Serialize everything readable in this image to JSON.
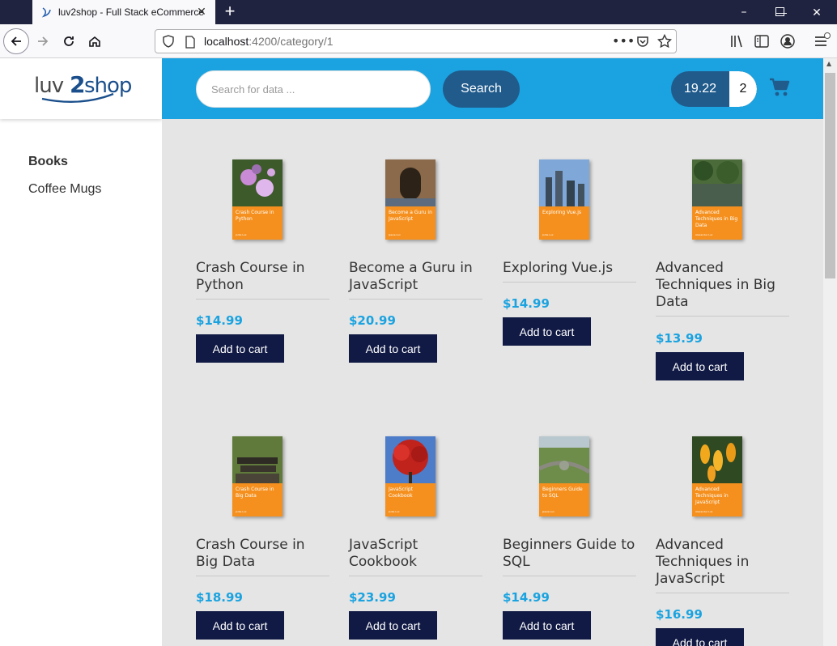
{
  "browser": {
    "tab_title": "luv2shop - Full Stack eCommerce",
    "url_host": "localhost",
    "url_rest": ":4200/category/1",
    "new_tab_label": "+",
    "tab_close": "✕"
  },
  "brand": {
    "logo_text": "luv2shop"
  },
  "sidebar": {
    "categories": [
      {
        "label": "Books"
      },
      {
        "label": "Coffee Mugs"
      }
    ]
  },
  "header": {
    "search_placeholder": "Search for data ...",
    "search_label": "Search",
    "cart_total": "19.22",
    "cart_quantity": "2"
  },
  "products": [
    {
      "name": "Crash Course in Python",
      "price": "$14.99",
      "button": "Add to cart",
      "cover_title": "Crash Course in Python",
      "cover_author": "Jodie Lux"
    },
    {
      "name": "Become a Guru in JavaScript",
      "price": "$20.99",
      "button": "Add to cart",
      "cover_title": "Become a Guru in JavaScript",
      "cover_author": "Jessie Lux"
    },
    {
      "name": "Exploring Vue.js",
      "price": "$14.99",
      "button": "Add to cart",
      "cover_title": "Exploring Vue.js",
      "cover_author": "Jodie Lux"
    },
    {
      "name": "Advanced Techniques in Big Data",
      "price": "$13.99",
      "button": "Add to cart",
      "cover_title": "Advanced Techniques in Big Data",
      "cover_author": "Alexander Lux"
    },
    {
      "name": "Crash Course in Big Data",
      "price": "$18.99",
      "button": "Add to cart",
      "cover_title": "Crash Course in Big Data",
      "cover_author": "Jodie Lux"
    },
    {
      "name": "JavaScript Cookbook",
      "price": "$23.99",
      "button": "Add to cart",
      "cover_title": "JavaScript Cookbook",
      "cover_author": "Jodie Lux"
    },
    {
      "name": "Beginners Guide to SQL",
      "price": "$14.99",
      "button": "Add to cart",
      "cover_title": "Beginners Guide to SQL",
      "cover_author": "Jessie Lux"
    },
    {
      "name": "Advanced Techniques in JavaScript",
      "price": "$16.99",
      "button": "Add to cart",
      "cover_title": "Advanced Techniques in JavaScript",
      "cover_author": "Alexander Lux"
    }
  ],
  "colors": {
    "header_bg": "#1aa3e0",
    "button_dark": "#111a45",
    "search_button": "#205b8c",
    "price": "#1aa3e0",
    "cover_band": "#f5901e"
  }
}
